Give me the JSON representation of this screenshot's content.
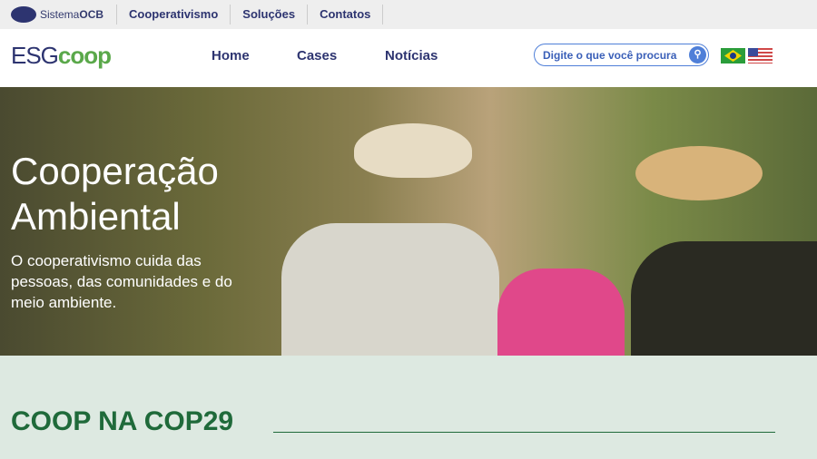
{
  "topbar": {
    "brand_prefix": "Sistema",
    "brand_bold": "OCB",
    "links": [
      "Cooperativismo",
      "Soluções",
      "Contatos"
    ]
  },
  "header": {
    "logo_esg": "ESG",
    "logo_coop": "COOP",
    "nav": [
      "Home",
      "Cases",
      "Notícias"
    ],
    "search_placeholder": "Digite o que você procura"
  },
  "hero": {
    "title": "Cooperação Ambiental",
    "subtitle": "O cooperativismo cuida das pessoas, das comunidades e do meio ambiente."
  },
  "section": {
    "title": "COOP NA COP29"
  }
}
